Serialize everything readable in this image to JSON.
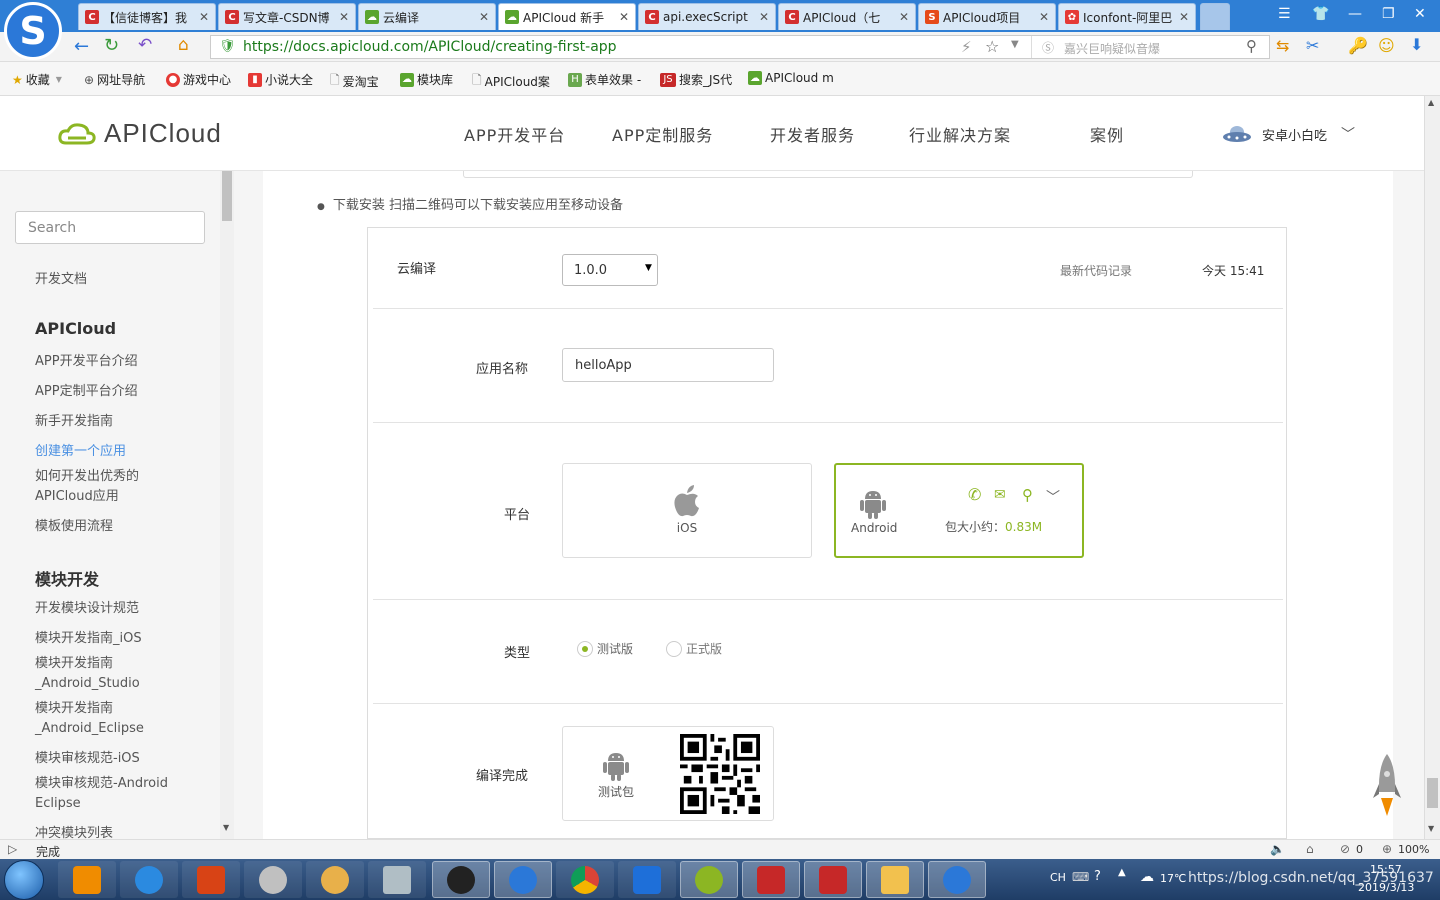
{
  "browser": {
    "tabs": [
      {
        "label": "【信徒博客】我",
        "color": "#d32f2f",
        "glyph": "C"
      },
      {
        "label": "写文章-CSDN博",
        "color": "#d32f2f",
        "glyph": "C"
      },
      {
        "label": "云编译",
        "color": "#5aa52e",
        "glyph": "☁"
      },
      {
        "label": "APICloud 新手",
        "color": "#5aa52e",
        "glyph": "☁"
      },
      {
        "label": "api.execScript",
        "color": "#d32f2f",
        "glyph": "C"
      },
      {
        "label": "APICloud（七",
        "color": "#d32f2f",
        "glyph": "C"
      },
      {
        "label": "APICloud项目",
        "color": "#e64a19",
        "glyph": "S"
      },
      {
        "label": "Iconfont-阿里巴",
        "color": "#e53935",
        "glyph": "✿"
      }
    ],
    "url": "https://docs.apicloud.com/APICloud/creating-first-app",
    "search_placeholder": "嘉兴巨响疑似音爆",
    "bookmarks": [
      "收藏",
      "网址导航",
      "游戏中心",
      "小说大全",
      "爱淘宝",
      "模块库",
      "APICloud案",
      "表单效果 -",
      "搜索_JS代",
      "APICloud m"
    ]
  },
  "site": {
    "logo_text": "APICloud",
    "nav": [
      "APP开发平台",
      "APP定制服务",
      "开发者服务",
      "行业解决方案",
      "案例"
    ],
    "user_name": "安卓小白吃"
  },
  "sidebar": {
    "search_placeholder": "Search",
    "top_link": "开发文档",
    "sections": [
      {
        "title": "APICloud",
        "items": [
          "APP开发平台介绍",
          "APP定制平台介绍",
          "新手开发指南",
          "创建第一个应用",
          "如何开发出优秀的",
          "APICloud应用",
          "模板使用流程"
        ]
      },
      {
        "title": "模块开发",
        "items": [
          "开发模块设计规范",
          "模块开发指南_iOS",
          "模块开发指南",
          "_Android_Studio",
          "模块开发指南",
          "_Android_Eclipse",
          "模块审核规范-iOS",
          "模块审核规范-Android",
          "Eclipse",
          "冲突模块列表"
        ]
      }
    ],
    "active_item": "创建第一个应用"
  },
  "content": {
    "bullet_text": "下载安装 扫描二维码可以下载安装应用至移动设备",
    "compile": {
      "title": "云编译",
      "version": "1.0.0",
      "latest_record": "最新代码记录",
      "time": "今天 15:41"
    },
    "app_name_label": "应用名称",
    "app_name_value": "helloApp",
    "platform_label": "平台",
    "platforms": {
      "ios": "iOS",
      "android": "Android"
    },
    "package_size_label": "包大小约：",
    "package_size_value": "0.83M",
    "type_label": "类型",
    "type_options": [
      "测试版",
      "正式版"
    ],
    "compile_done_label": "编译完成",
    "test_package": "测试包"
  },
  "status": {
    "text": "完成",
    "zoom": "100%",
    "count": "0"
  },
  "taskbar": {
    "lang": "CH",
    "temp": "17℃",
    "time": "15:57",
    "date": "2019/3/13",
    "watermark": "https://blog.csdn.net/qq_37591637"
  },
  "colors": {
    "accent_green": "#8cb623",
    "link_blue": "#4a90e2",
    "browser_blue": "#2f7fd5"
  }
}
